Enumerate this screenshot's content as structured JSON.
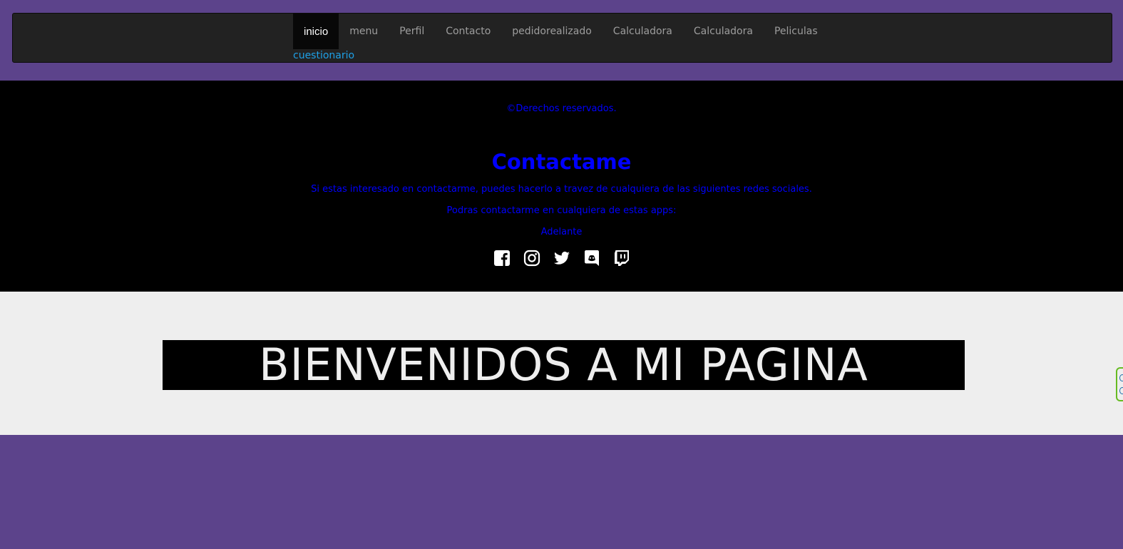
{
  "nav": {
    "items": [
      {
        "label": "inicio",
        "active": true
      },
      {
        "label": "menu"
      },
      {
        "label": "Perfil"
      },
      {
        "label": "Contacto"
      },
      {
        "label": "pedidorealizado"
      },
      {
        "label": "Calculadora"
      },
      {
        "label": "Calculadora"
      },
      {
        "label": "Peliculas"
      }
    ],
    "extra_label": "cuestionario"
  },
  "footer": {
    "copyright": "©Derechos reservados.",
    "title": "Contactame",
    "text": "Si estas interesado en contactarme, puedes hacerlo a travez de cualquiera de las siguientes redes sociales.",
    "apps_text": "Podras contactarme en cualquiera de estas apps:",
    "next_link": "Adelante",
    "socials": [
      "facebook-icon",
      "instagram-icon",
      "twitter-icon",
      "discord-icon",
      "twitch-icon"
    ]
  },
  "hero": {
    "title": "BIENVENIDOS A MI PAGINA"
  },
  "colors": {
    "page_bg": "#5c438b",
    "navbar_bg": "#222222",
    "footer_text": "#0000ff",
    "link": "#1ea0e6",
    "hero_bg": "#eeeeee"
  }
}
